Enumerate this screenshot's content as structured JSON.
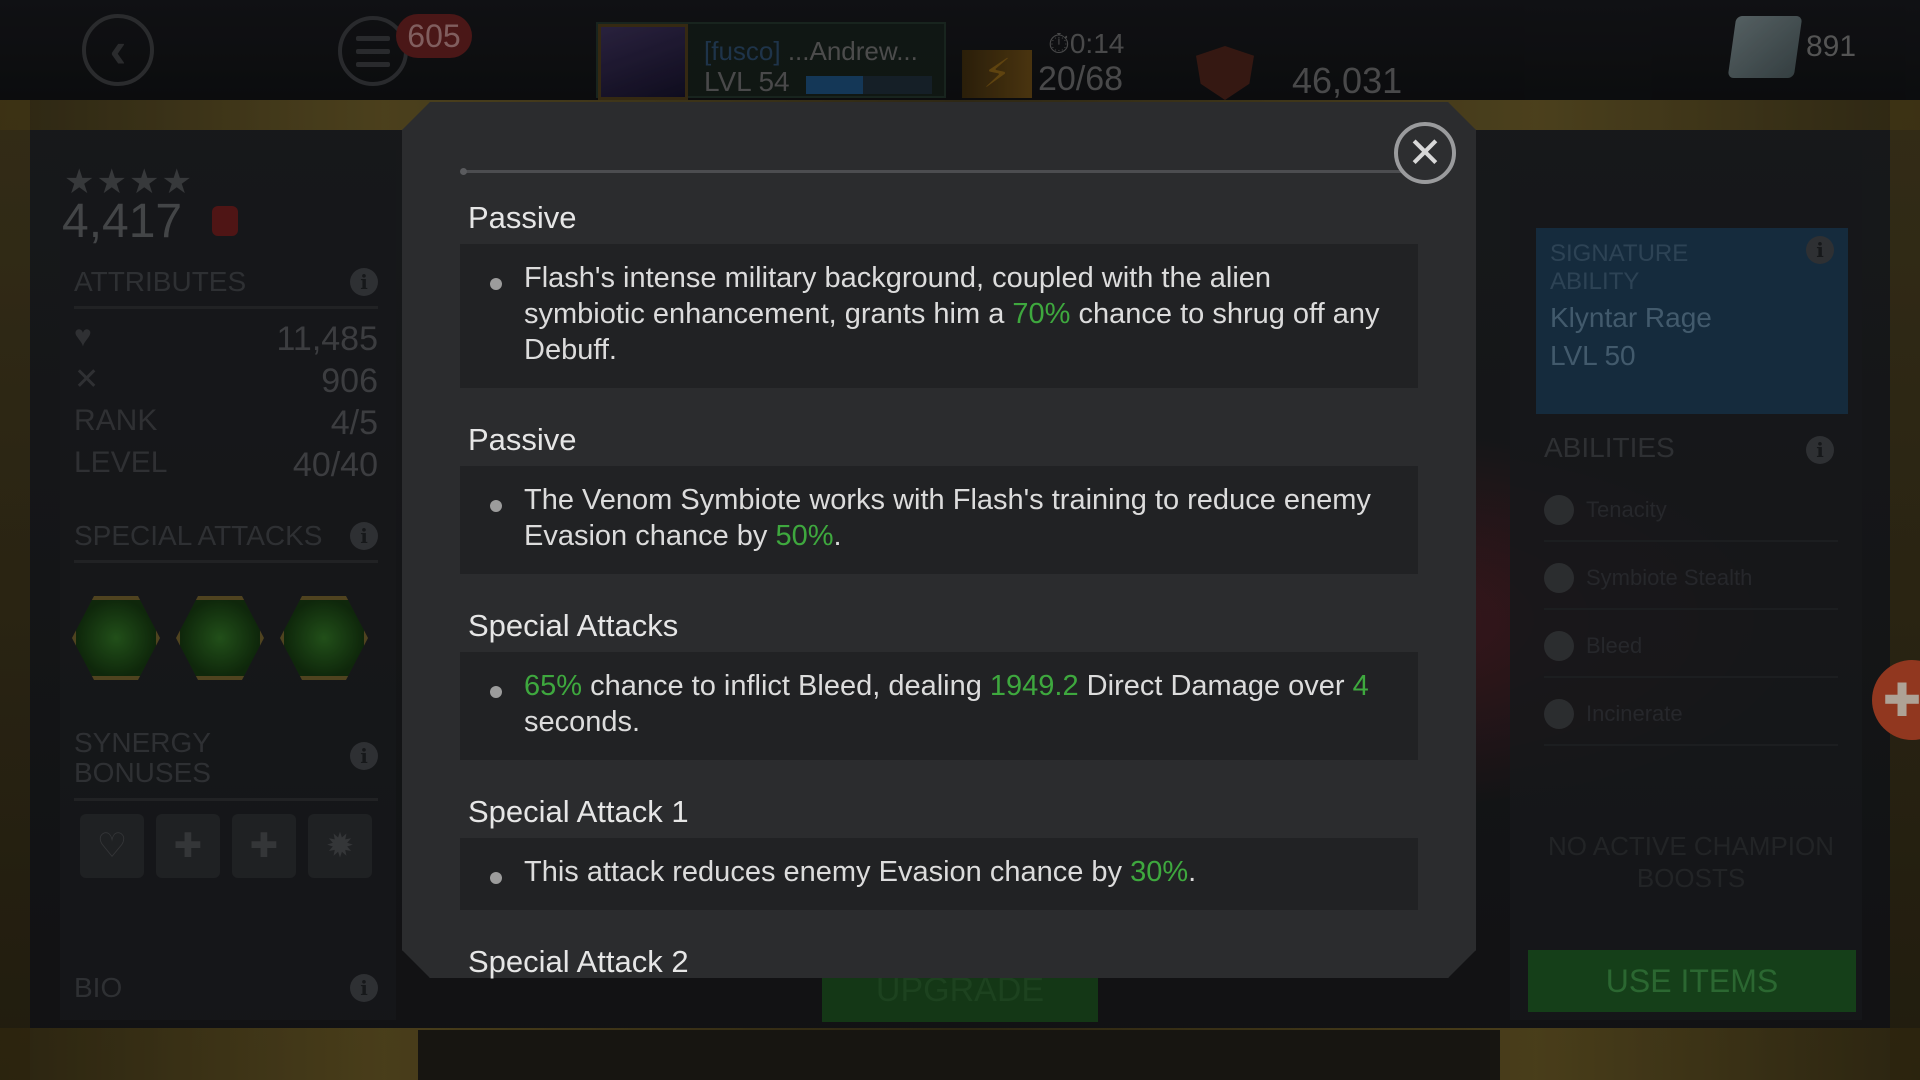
{
  "topbar": {
    "notifications": "605",
    "player_tag": "[fusco]",
    "player_name": " ...Andrew...",
    "player_level": "LVL 54",
    "xp_fraction": 0.45,
    "timer": "0:14",
    "energy": "20/68",
    "gold": "46,031",
    "units": "891"
  },
  "left_panel": {
    "stars": "★★★★",
    "rating": "4,417",
    "attributes_label": "ATTRIBUTES",
    "health": "11,485",
    "attack": "906",
    "rank_label": "RANK",
    "rank": "4/5",
    "level_label": "LEVEL",
    "level": "40/40",
    "special_attacks_label": "SPECIAL ATTACKS",
    "synergy_label_1": "SYNERGY",
    "synergy_label_2": "BONUSES",
    "bio_label": "BIO"
  },
  "right_panel": {
    "sig_label_1": "SIGNATURE",
    "sig_label_2": "ABILITY",
    "sig_name": "Klyntar Rage",
    "sig_level": "LVL 50",
    "abilities_label": "ABILITIES",
    "abilities": [
      "Tenacity",
      "Symbiote Stealth",
      "Bleed",
      "Incinerate"
    ],
    "no_boosts": "NO ACTIVE CHAMPION BOOSTS",
    "use_items": "USE ITEMS"
  },
  "upgrade_label": "UPGRADE",
  "modal": {
    "close_icon": "close-x",
    "sections": [
      {
        "title": "Passive",
        "parts": [
          {
            "text": "Flash's intense military background, coupled with the alien symbiotic enhancement, grants him a ",
            "hl": false
          },
          {
            "text": "70%",
            "hl": true
          },
          {
            "text": " chance to shrug off any Debuff.",
            "hl": false
          }
        ]
      },
      {
        "title": "Passive",
        "parts": [
          {
            "text": "The Venom Symbiote works with Flash's training to reduce enemy Evasion chance by ",
            "hl": false
          },
          {
            "text": "50%",
            "hl": true
          },
          {
            "text": ".",
            "hl": false
          }
        ]
      },
      {
        "title": "Special Attacks",
        "parts": [
          {
            "text": "65%",
            "hl": true
          },
          {
            "text": " chance to inflict Bleed, dealing ",
            "hl": false
          },
          {
            "text": "1949.2",
            "hl": true
          },
          {
            "text": " Direct Damage over ",
            "hl": false
          },
          {
            "text": "4",
            "hl": true
          },
          {
            "text": " seconds.",
            "hl": false
          }
        ]
      },
      {
        "title": "Special Attack 1",
        "parts": [
          {
            "text": "This attack reduces enemy Evasion chance by ",
            "hl": false
          },
          {
            "text": "30%",
            "hl": true
          },
          {
            "text": ".",
            "hl": false
          }
        ]
      },
      {
        "title": "Special Attack 2",
        "parts": []
      }
    ]
  },
  "colors": {
    "highlight": "#3ea83e",
    "modal_bg": "#2b2c2e",
    "desc_bg": "#212224"
  }
}
